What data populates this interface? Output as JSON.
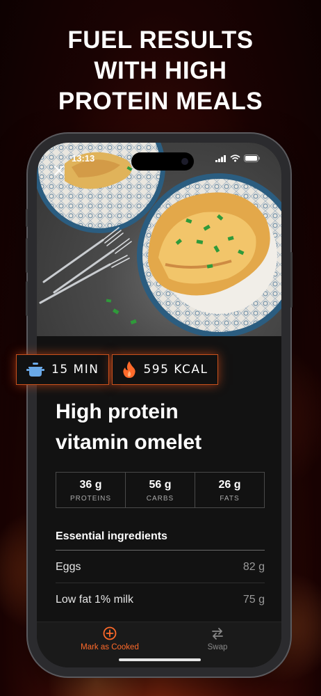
{
  "headline": {
    "line1": "FUEL RESULTS",
    "line2": "WITH HIGH",
    "line3": "PROTEIN MEALS"
  },
  "status_bar": {
    "time": "13:13"
  },
  "meal": {
    "time_badge": "15 MIN",
    "calories_badge": "595 KCAL",
    "title_line1": "High protein",
    "title_line2": "vitamin omelet",
    "macros": [
      {
        "value": "36 g",
        "label": "PROTEINS"
      },
      {
        "value": "56 g",
        "label": "CARBS"
      },
      {
        "value": "26 g",
        "label": "FATS"
      }
    ]
  },
  "ingredients": {
    "heading": "Essential ingredients",
    "items": [
      {
        "name": "Eggs",
        "amount": "82 g"
      },
      {
        "name": "Low fat 1% milk",
        "amount": "75 g"
      }
    ]
  },
  "tabbar": {
    "cooked_label": "Mark as Cooked",
    "swap_label": "Swap"
  },
  "colors": {
    "accent": "#ff6a2a",
    "badge_border": "#c9511c",
    "background_dark": "#121212"
  },
  "icons": {
    "close": "close-icon",
    "pot": "pot-icon",
    "flame": "flame-icon",
    "plus_circle": "plus-circle-icon",
    "swap": "swap-arrows-icon"
  }
}
